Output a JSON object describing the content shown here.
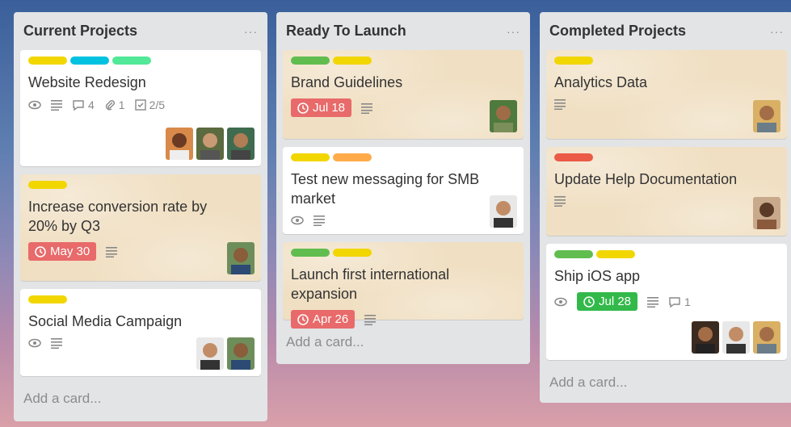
{
  "colors": {
    "yellow": "#f2d600",
    "blue": "#00c2e0",
    "teal": "#51e898",
    "green": "#61bd4f",
    "orange": "#ffab4a",
    "red": "#eb5a46",
    "due_red": "#e86a6a",
    "due_green": "#32b94a"
  },
  "lists": [
    {
      "title": "Current Projects",
      "menu": "···",
      "add_card": "Add a card...",
      "cards": [
        {
          "title": "Website Redesign",
          "labels": [
            "yellow",
            "blue",
            "teal"
          ],
          "comments": "4",
          "attachments": "1",
          "checklist": "2/5"
        },
        {
          "title": "Increase conversion rate by 20% by Q3",
          "labels": [
            "yellow"
          ],
          "due": "May 30"
        },
        {
          "title": "Social Media Campaign",
          "labels": [
            "yellow"
          ]
        }
      ]
    },
    {
      "title": "Ready To Launch",
      "menu": "···",
      "add_card": "Add a card...",
      "cards": [
        {
          "title": "Brand Guidelines",
          "labels": [
            "green",
            "yellow"
          ],
          "due": "Jul 18"
        },
        {
          "title": "Test new messaging for SMB market",
          "labels": [
            "yellow",
            "orange"
          ]
        },
        {
          "title": "Launch first international expansion",
          "labels": [
            "green",
            "yellow"
          ],
          "due": "Apr 26"
        }
      ]
    },
    {
      "title": "Completed Projects",
      "menu": "···",
      "add_card": "Add a card...",
      "cards": [
        {
          "title": "Analytics Data",
          "labels": [
            "yellow"
          ]
        },
        {
          "title": "Update Help Documentation",
          "labels": [
            "red"
          ]
        },
        {
          "title": "Ship iOS app",
          "labels": [
            "green",
            "yellow"
          ],
          "due": "Jul 28",
          "comments": "1"
        }
      ]
    }
  ]
}
